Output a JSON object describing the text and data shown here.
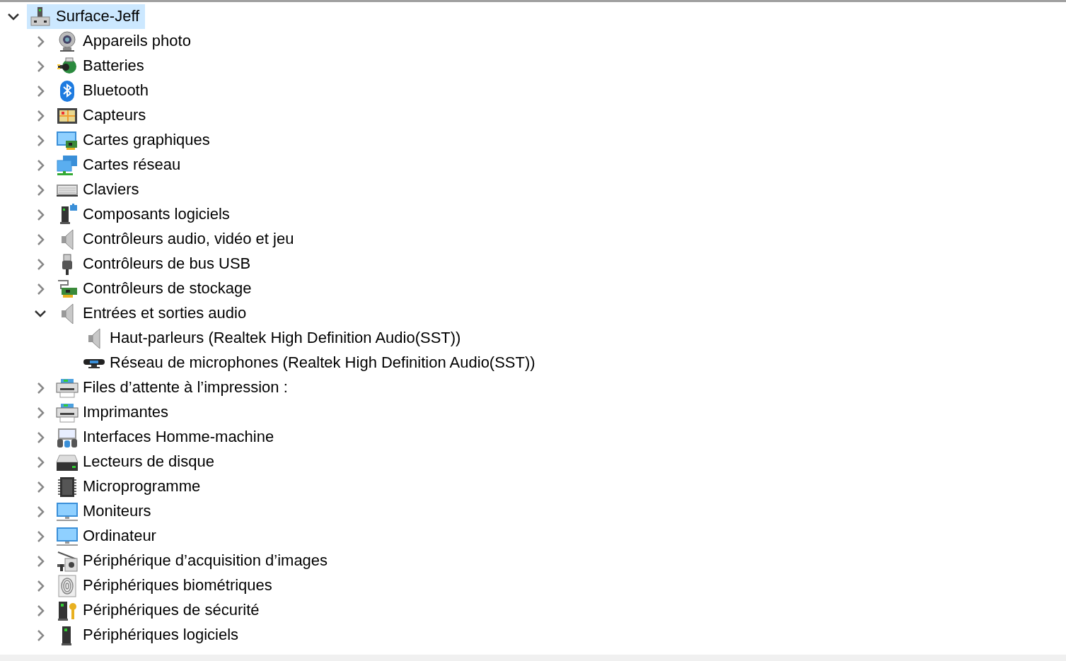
{
  "tree": [
    {
      "label": "Surface-Jeff",
      "kind": "computer-tower",
      "expanded": true,
      "selected": true,
      "children": [
        {
          "label": "Appareils photo",
          "kind": "webcam",
          "expanded": false,
          "selected": false
        },
        {
          "label": "Batteries",
          "kind": "battery",
          "expanded": false,
          "selected": false
        },
        {
          "label": "Bluetooth",
          "kind": "bluetooth",
          "expanded": false,
          "selected": false
        },
        {
          "label": "Capteurs",
          "kind": "sensor",
          "expanded": false,
          "selected": false
        },
        {
          "label": "Cartes graphiques",
          "kind": "graphics",
          "expanded": false,
          "selected": false
        },
        {
          "label": "Cartes réseau",
          "kind": "network",
          "expanded": false,
          "selected": false
        },
        {
          "label": "Claviers",
          "kind": "keyboard",
          "expanded": false,
          "selected": false
        },
        {
          "label": "Composants logiciels",
          "kind": "software",
          "expanded": false,
          "selected": false
        },
        {
          "label": "Contrôleurs audio, vidéo et jeu",
          "kind": "speaker",
          "expanded": false,
          "selected": false
        },
        {
          "label": "Contrôleurs de bus USB",
          "kind": "usb",
          "expanded": false,
          "selected": false
        },
        {
          "label": "Contrôleurs de stockage",
          "kind": "storage",
          "expanded": false,
          "selected": false
        },
        {
          "label": "Entrées et sorties audio",
          "kind": "speaker",
          "expanded": true,
          "selected": false,
          "children": [
            {
              "label": "Haut-parleurs (Realtek High Definition Audio(SST))",
              "kind": "speaker",
              "selected": false
            },
            {
              "label": "Réseau de microphones (Realtek High Definition Audio(SST))",
              "kind": "microphone-array",
              "selected": false
            }
          ]
        },
        {
          "label": "Files d’attente à l’impression :",
          "kind": "printer",
          "expanded": false,
          "selected": false
        },
        {
          "label": "Imprimantes",
          "kind": "printer",
          "expanded": false,
          "selected": false
        },
        {
          "label": "Interfaces Homme-machine",
          "kind": "hid",
          "expanded": false,
          "selected": false
        },
        {
          "label": "Lecteurs de disque",
          "kind": "disk",
          "expanded": false,
          "selected": false
        },
        {
          "label": "Microprogramme",
          "kind": "chip",
          "expanded": false,
          "selected": false
        },
        {
          "label": "Moniteurs",
          "kind": "monitor",
          "expanded": false,
          "selected": false
        },
        {
          "label": "Ordinateur",
          "kind": "monitor",
          "expanded": false,
          "selected": false
        },
        {
          "label": "Périphérique d’acquisition d’images",
          "kind": "scanner",
          "expanded": false,
          "selected": false
        },
        {
          "label": "Périphériques biométriques",
          "kind": "fingerprint",
          "expanded": false,
          "selected": false
        },
        {
          "label": "Périphériques de sécurité",
          "kind": "security",
          "expanded": false,
          "selected": false
        },
        {
          "label": "Périphériques logiciels",
          "kind": "software-device",
          "expanded": false,
          "selected": false
        }
      ]
    }
  ]
}
